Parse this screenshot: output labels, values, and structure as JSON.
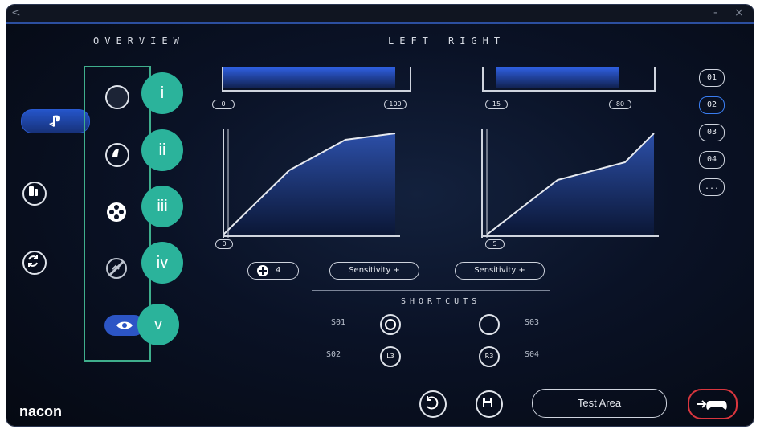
{
  "window": {
    "back": "<",
    "minimize": "-",
    "close": "×"
  },
  "overview": {
    "title": "OVERVIEW"
  },
  "left_right": {
    "left": "LEFT",
    "right": "RIGHT"
  },
  "badges": [
    "i",
    "ii",
    "iii",
    "iv",
    "v"
  ],
  "left_panel": {
    "range_min": "0",
    "range_max": "100",
    "curve_start": "0",
    "button_preset": "4",
    "sensitivity": "Sensitivity +"
  },
  "right_panel": {
    "range_min": "15",
    "range_max": "80",
    "curve_start": "5",
    "sensitivity": "Sensitivity +"
  },
  "profiles": [
    "01",
    "02",
    "03",
    "04",
    "..."
  ],
  "shortcuts": {
    "title": "SHORTCUTS",
    "s1": "S01",
    "s2": "S02",
    "s3": "S03",
    "s4": "S04",
    "l3": "L3",
    "r3": "R3"
  },
  "footer": {
    "logo": "nacon",
    "test_area": "Test Area"
  },
  "icons": {
    "ps_button": "playstation-icon",
    "device": "device-icon",
    "sync": "sync-icon",
    "stick": "stick-icon",
    "trigger": "trigger-icon",
    "buttons": "buttons-icon",
    "vibration": "vibration-icon",
    "eye": "eye-icon",
    "undo": "undo-icon",
    "save": "save-icon",
    "export": "export-to-controller-icon"
  }
}
